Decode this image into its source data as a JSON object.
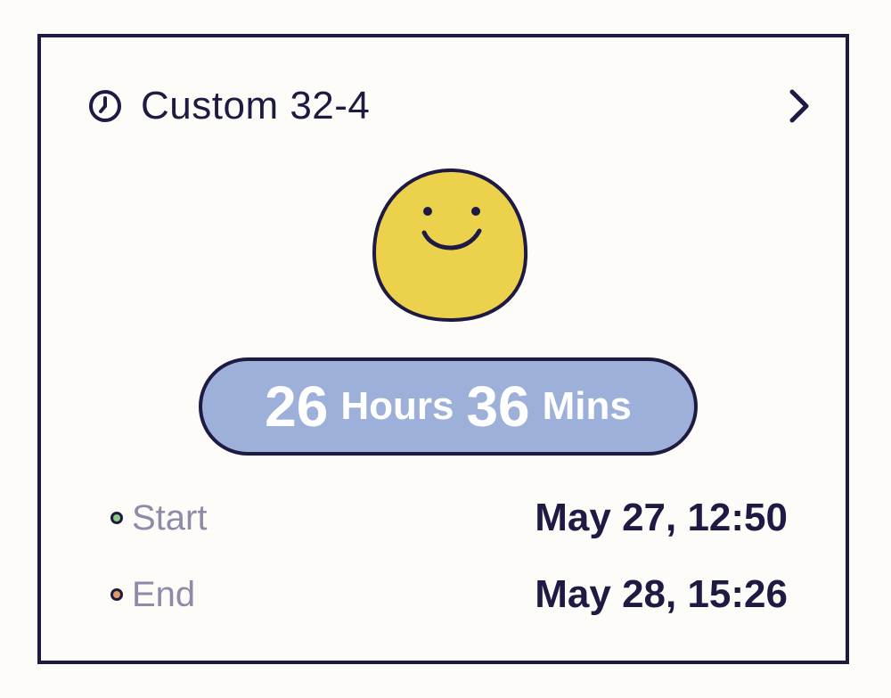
{
  "card": {
    "title": "Custom 32-4",
    "icons": {
      "title_icon": "clock-icon",
      "nav_icon": "chevron-right-icon",
      "mood_icon": "smiley-face-icon"
    }
  },
  "duration": {
    "hours_value": "26",
    "hours_unit": "Hours",
    "minutes_value": "36",
    "minutes_unit": "Mins"
  },
  "times": {
    "start_label": "Start",
    "start_value": "May 27, 12:50",
    "end_label": "End",
    "end_value": "May 28, 15:26"
  },
  "colors": {
    "ink": "#1f1a44",
    "pill": "#9cb0d9",
    "face": "#ecd24c",
    "start_dot": "#8ccb7d",
    "end_dot": "#e39a62",
    "muted_label": "#8f8aa8"
  }
}
